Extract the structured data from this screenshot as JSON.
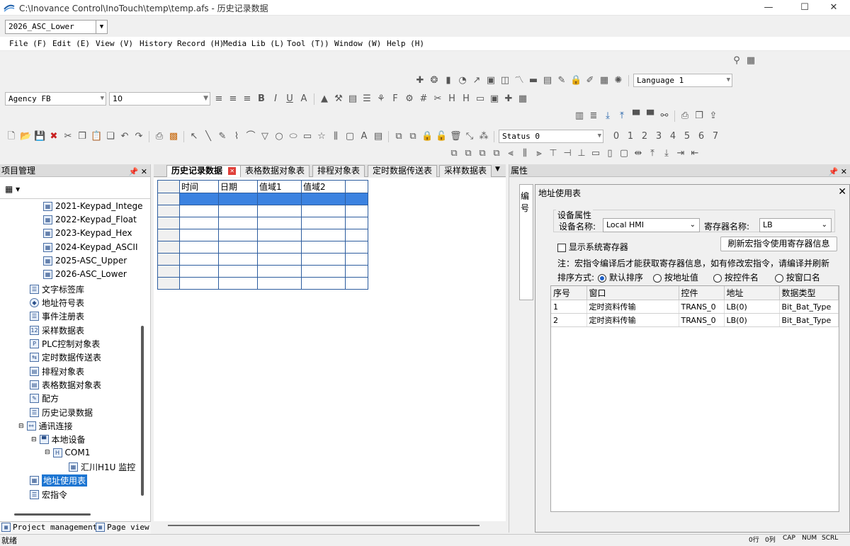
{
  "window": {
    "title": "C:\\Inovance Control\\InoTouch\\temp\\temp.afs - 历史记录数据",
    "minimize": "—",
    "maximize": "☐",
    "close": "✕"
  },
  "project_combo": {
    "value": "2026_ASC_Lower"
  },
  "menu": [
    "File (F)",
    "Edit (E)",
    "View (V)",
    "History Record (H)",
    "Media Lib (L)",
    "Tool (T))",
    "Window (W)",
    "Help (H)"
  ],
  "toolbar": {
    "language": "Language 1",
    "font": "Agency FB",
    "font_size": "10",
    "status": "Status 0",
    "status_numbers": [
      "0",
      "1",
      "2",
      "3",
      "4",
      "5",
      "6",
      "7"
    ]
  },
  "left_panel": {
    "title": "项目管理",
    "items": [
      "2021-Keypad_Intege",
      "2022-Keypad_Float",
      "2023-Keypad_Hex",
      "2024-Keypad_ASCII",
      "2025-ASC_Upper",
      "2026-ASC_Lower",
      "文字标签库",
      "地址符号表",
      "事件注册表",
      "采样数据表",
      "PLC控制对象表",
      "定时数据传送表",
      "排程对象表",
      "表格数据对象表",
      "配方",
      "历史记录数据",
      "通讯连接",
      "本地设备",
      "COM1",
      "汇川H1U 监控",
      "地址使用表",
      "宏指令"
    ],
    "tab_project": "Project management",
    "tab_page": "Page view"
  },
  "center": {
    "tabs": [
      "历史记录数据",
      "表格数据对象表",
      "排程对象表",
      "定时数据传送表",
      "采样数据表"
    ],
    "grid_headers": [
      "时间",
      "日期",
      "值域1",
      "值域2",
      ""
    ]
  },
  "prop_panel": {
    "title": "属性",
    "partial_label": "编号"
  },
  "dialog": {
    "title": "地址使用表",
    "group_label": "设备属性",
    "device_label": "设备名称:",
    "device_value": "Local HMI",
    "register_label": "寄存器名称:",
    "register_value": "LB",
    "show_system": "显示系统寄存器",
    "refresh_button": "刷新宏指令使用寄存器信息",
    "note": "注：宏指令编译后才能获取寄存器信息，如有修改宏指令，请编译并刷新",
    "sort_label": "排序方式:",
    "sort_options": [
      "默认排序",
      "按地址值",
      "按控件名",
      "按窗口名"
    ],
    "table_headers": [
      "序号",
      "窗口",
      "控件",
      "地址",
      "数据类型"
    ],
    "rows": [
      [
        "1",
        "定时资料传输",
        "TRANS_0",
        "LB(0)",
        "Bit_Bat_Type"
      ],
      [
        "2",
        "定时资料传输",
        "TRANS_0",
        "LB(0)",
        "Bit_Bat_Type"
      ]
    ]
  },
  "statusbar": {
    "left": "就绪",
    "indicators": [
      "0行",
      "0列",
      "CAP",
      "NUM",
      "SCRL"
    ]
  }
}
